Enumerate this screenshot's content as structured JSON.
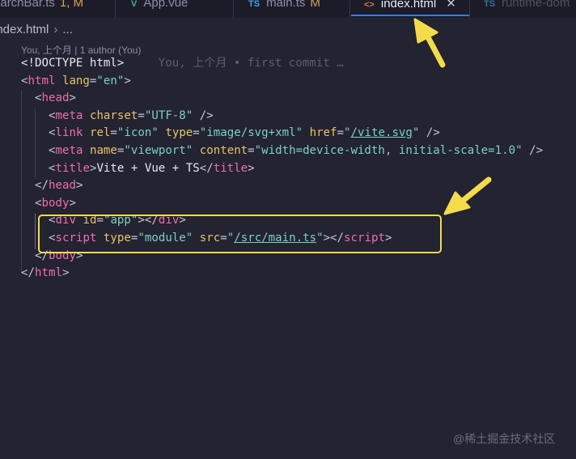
{
  "tabs": [
    {
      "name": "SearchBar.ts",
      "icon": "",
      "status": "1, M",
      "state": "inactive"
    },
    {
      "name": "App.vue",
      "icon": "V",
      "status": "",
      "state": "inactive"
    },
    {
      "name": "main.ts",
      "icon": "TS",
      "status": "M",
      "state": "inactive"
    },
    {
      "name": "index.html",
      "icon": "<>",
      "status": "",
      "state": "active"
    },
    {
      "name": "runtime-dom",
      "icon": "TS",
      "status": "",
      "state": "inactive"
    }
  ],
  "breadcrumb": {
    "file": "index.html",
    "more": "..."
  },
  "codelens": "You, 上个月 | 1 author (You)",
  "blame": "You, 上个月 • first commit …",
  "code": {
    "doctype": "<!DOCTYPE html>",
    "html_tag": "html",
    "head_tag": "head",
    "meta_tag": "meta",
    "link_tag": "link",
    "title_tag": "title",
    "body_tag": "body",
    "div_tag": "div",
    "script_tag": "script",
    "lang_attr": "lang",
    "lang_val": "\"en\"",
    "charset_attr": "charset",
    "charset_val": "\"UTF-8\"",
    "rel_attr": "rel",
    "rel_val": "\"icon\"",
    "type_attr": "type",
    "type_svg_val": "\"image/svg+xml\"",
    "href_attr": "href",
    "href_val": "/vite.svg",
    "name_attr": "name",
    "name_val": "\"viewport\"",
    "content_attr": "content",
    "content_val": "\"width=device-width, initial-scale=1.0\"",
    "title_text": "Vite + Vue + TS",
    "id_attr": "id",
    "id_val": "\"app\"",
    "module_val": "\"module\"",
    "src_attr": "src",
    "src_val": "/src/main.ts"
  },
  "watermark": "@稀土掘金技术社区",
  "colors": {
    "highlight_box": "#f3dc4a",
    "arrow": "#f3dc4a",
    "active_tab_border": "#3c7bdc"
  }
}
